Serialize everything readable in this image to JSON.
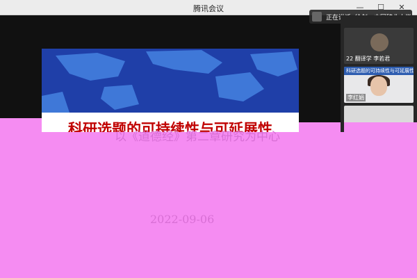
{
  "window": {
    "title": "腾讯会议",
    "controls": {
      "minimize": "—",
      "maximize": "☐",
      "close": "✕"
    }
  },
  "speaking_banner": {
    "text": "正在讲话: 徐剑—中国矿业大学"
  },
  "slide": {
    "title": "科研选题的可持续性与可延展性",
    "subtitle": "以《道德经》第二章研究为中心",
    "bottom_text": "2022-09-06",
    "colors": {
      "title": "#c00000",
      "map_ocean": "#1f3fa8",
      "map_land": "#3f78d8"
    }
  },
  "participants": [
    {
      "name": "22 翻译学 李若君",
      "icon": "avatar-photo"
    },
    {
      "name": "李红娟",
      "strip_text": "科研选题的可持续性与可延展性",
      "icon": "mic-icon"
    },
    {
      "name": "",
      "icon": "video-tile"
    }
  ],
  "overlay": {
    "color": "#f58cf2"
  }
}
